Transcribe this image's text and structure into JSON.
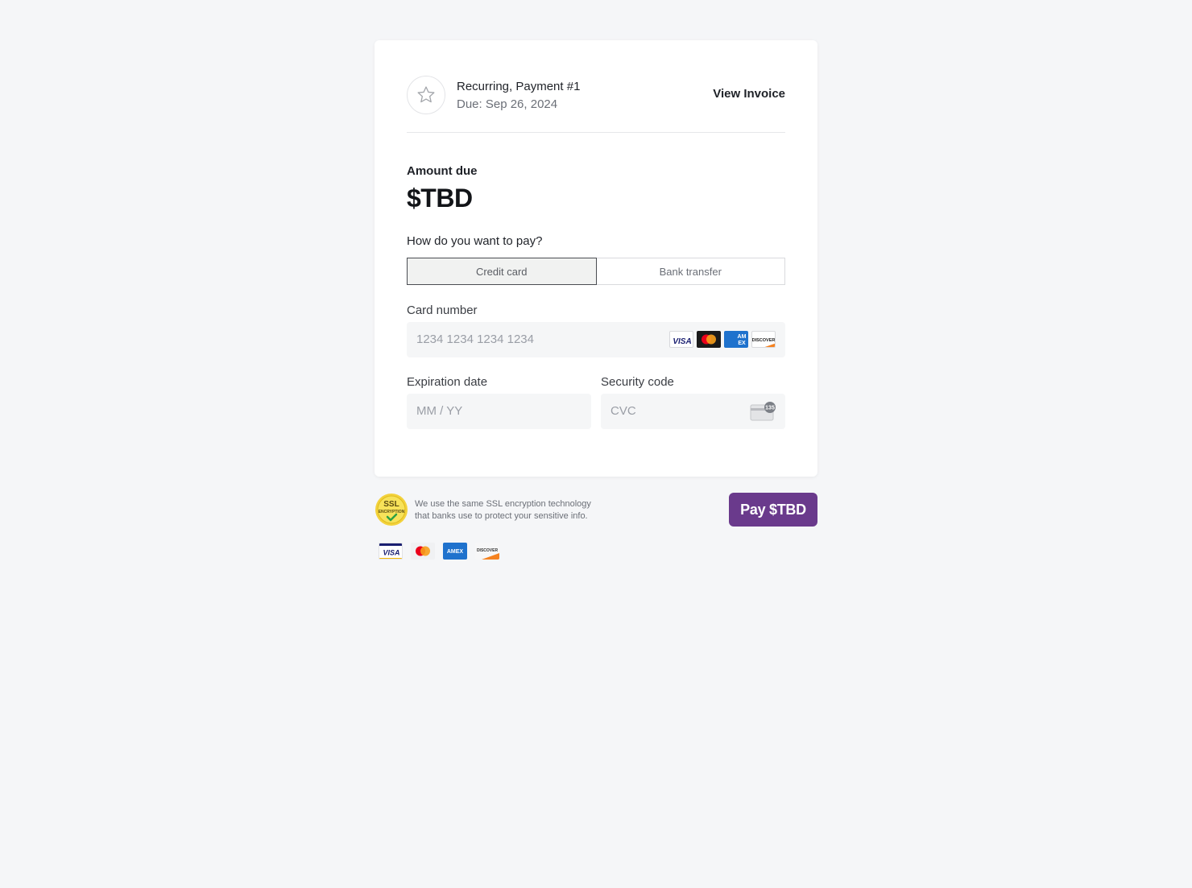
{
  "header": {
    "title": "Recurring, Payment #1",
    "due": "Due: Sep 26, 2024",
    "view_invoice": "View Invoice",
    "badge_icon": "star-icon"
  },
  "amount": {
    "label": "Amount due",
    "value": "$TBD"
  },
  "payment_method": {
    "question": "How do you want to pay?",
    "options": [
      "Credit card",
      "Bank transfer"
    ],
    "selected": "Credit card"
  },
  "card_number": {
    "label": "Card number",
    "placeholder": "1234 1234 1234 1234",
    "brands": [
      "visa",
      "mastercard",
      "amex",
      "discover"
    ]
  },
  "expiration": {
    "label": "Expiration date",
    "placeholder": "MM / YY"
  },
  "security_code": {
    "label": "Security code",
    "placeholder": "CVC",
    "icon_text": "135"
  },
  "footer": {
    "ssl_line1": "We use the same SSL encryption technology",
    "ssl_line2": "that banks use to protect your sensitive info.",
    "pay_button": "Pay $TBD"
  },
  "colors": {
    "accent": "#6a3a8c",
    "background": "#f5f6f8",
    "card": "#ffffff"
  }
}
